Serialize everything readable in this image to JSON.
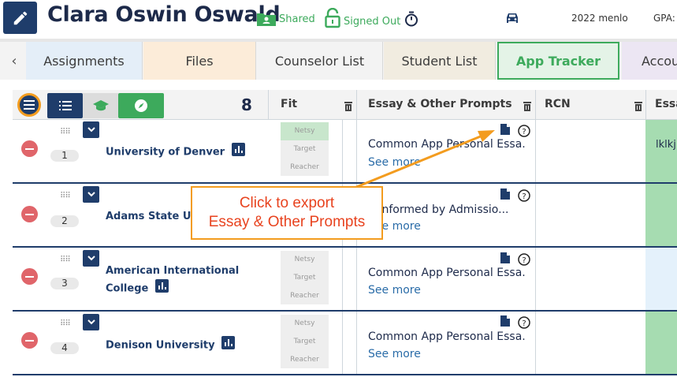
{
  "header": {
    "student_name": "Clara Oswin Oswald",
    "shared_label": "Shared",
    "signed_out_label": "Signed Out",
    "car_info": "2022 menlo",
    "gpa_label": "GPA:"
  },
  "tabs": [
    {
      "label": "Assignments",
      "color": "#e4eef8"
    },
    {
      "label": "Files",
      "color": "#fcecd9"
    },
    {
      "label": "Counselor List",
      "color": "#f3f3f3"
    },
    {
      "label": "Student List",
      "color": "#f1ece0"
    },
    {
      "label": "App Tracker",
      "color": "#e4f3e7",
      "active": true
    },
    {
      "label": "Accou",
      "color": "#ece6f3"
    }
  ],
  "toolbar": {
    "count": "8",
    "columns": {
      "fit": "Fit",
      "essay": "Essay & Other Prompts",
      "rcn": "RCN",
      "essay2": "Essa"
    }
  },
  "fit_levels": [
    "Netsy",
    "Target",
    "Reacher"
  ],
  "see_more": "See more",
  "rows": [
    {
      "rank": "1",
      "school": "University of Denver",
      "prompt": "Common App Personal Essa...",
      "fit_highlight": 0,
      "rcn": "lklkj"
    },
    {
      "rank": "2",
      "school": "Adams State Univ",
      "prompt": "9 Informed by Admissio...",
      "fit_highlight": -1,
      "rcn": ""
    },
    {
      "rank": "3",
      "school": "American International College",
      "school_lines": [
        "American International",
        "College"
      ],
      "prompt": "Common App Personal Essa...",
      "fit_highlight": -1,
      "rcn": ""
    },
    {
      "rank": "4",
      "school": "Denison University",
      "prompt": "Common App Personal Essa...",
      "fit_highlight": -1,
      "rcn": ""
    }
  ],
  "callout": {
    "line1": "Click to export",
    "line2": "Essay & Other Prompts"
  },
  "colors": {
    "navy": "#1f3d6b",
    "green": "#3daa5c",
    "orange": "#f39c1f",
    "callout_text": "#e8431f",
    "remove_red": "#e0656a"
  }
}
